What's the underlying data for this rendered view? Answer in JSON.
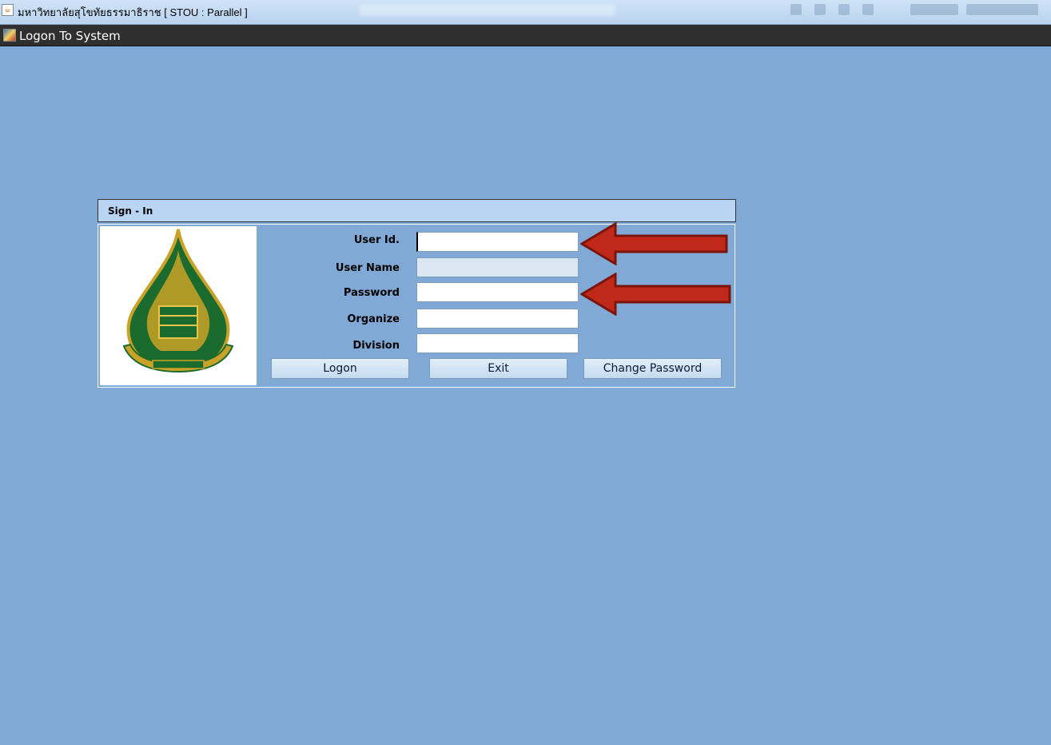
{
  "window": {
    "title": "มหาวิทยาลัยสุโขทัยธรรมาธิราช [ STOU : Parallel ]",
    "app_icon": "java-icon"
  },
  "menubar": {
    "icon": "form-icon",
    "title": "Logon To System"
  },
  "panel": {
    "header": "Sign - In",
    "logo": "university-emblem"
  },
  "fields": {
    "user_id": {
      "label": "User Id.",
      "value": ""
    },
    "user_name": {
      "label": "User Name",
      "value": ""
    },
    "password": {
      "label": "Password",
      "value": ""
    },
    "organize": {
      "label": "Organize",
      "value": ""
    },
    "division": {
      "label": "Division",
      "value": ""
    }
  },
  "buttons": {
    "logon": "Logon",
    "exit": "Exit",
    "change_password": "Change Password"
  },
  "colors": {
    "background": "#81a9d6",
    "header": "#b8d4f2",
    "arrow": "#c0281a"
  }
}
